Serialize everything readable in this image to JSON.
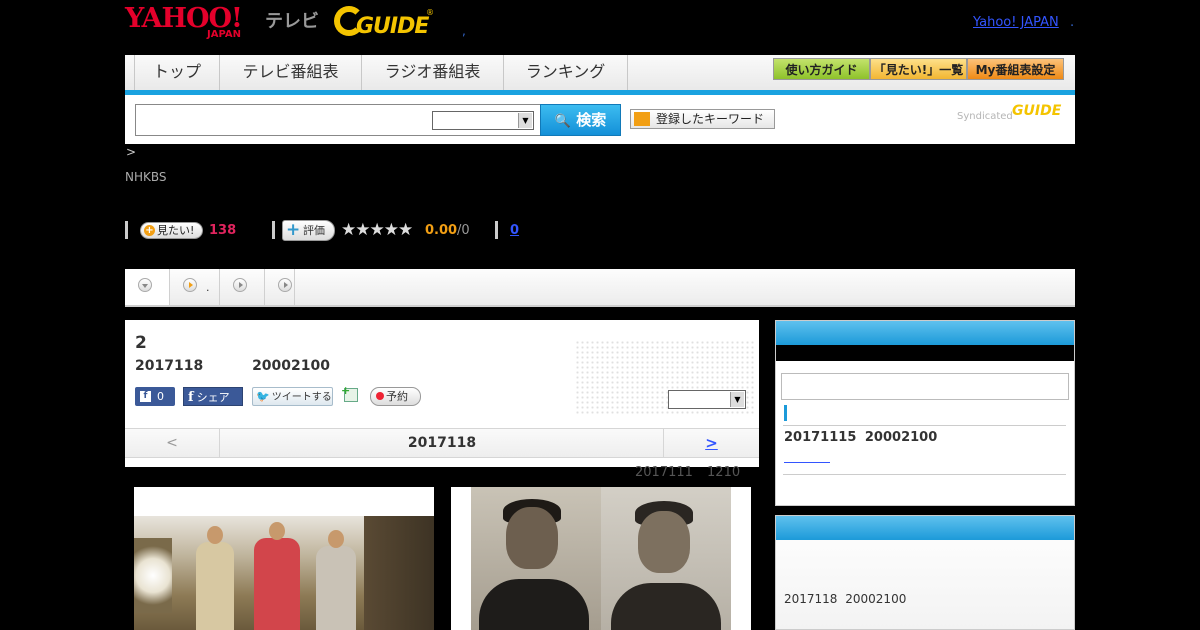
{
  "header": {
    "yahoo_logo": "YAHOO!",
    "yahoo_sub": "JAPAN",
    "tv_label": "テレビ",
    "gguide_logo": "GUIDE",
    "gguide_reg": "®",
    "dot": ",",
    "yahoo_japan_link": "Yahoo! JAPAN",
    "trailing_dot": "."
  },
  "nav": {
    "tabs": [
      {
        "label": "トップ"
      },
      {
        "label": "テレビ番組表"
      },
      {
        "label": "ラジオ番組表"
      },
      {
        "label": "ランキング"
      }
    ],
    "buttons": [
      {
        "label": "使い方ガイド",
        "color": "#9ccc3c"
      },
      {
        "label": "「見たい!」一覧",
        "color": "#f6c548"
      },
      {
        "label": "My番組表設定",
        "color": "#f39a2c"
      }
    ],
    "accent": "#1aa2e0"
  },
  "search": {
    "query": "",
    "select_value": "",
    "button_label": "検索",
    "keyword_button": "登録したキーワード",
    "syndicated": "Syndicated",
    "synd_logo": "GUIDE"
  },
  "program": {
    "breadcrumb": ">",
    "channel": "NHKBS",
    "mitai_label": "見たい!",
    "mitai_count": "138",
    "hyouka_label": "評価",
    "stars": "★★★★★",
    "rating": "0.00",
    "rating_total": "/0",
    "review_count": "0"
  },
  "subtabs": [
    {
      "label": ""
    },
    {
      "label": "."
    },
    {
      "label": ""
    },
    {
      "label": ""
    }
  ],
  "episode": {
    "title": "2",
    "date": "2017118 20002100",
    "fb_like_count": "0",
    "fb_share_label": "シェア",
    "tweet_label": "ツイートする",
    "reserve_label": "予約",
    "select_value": "",
    "pager": {
      "prev": "<",
      "current": "2017118",
      "next": ">"
    },
    "period": "2017111 1210"
  },
  "sidebar": {
    "search_value": "",
    "related_date": "20171115 20002100",
    "next_date": "2017118 20002100"
  }
}
